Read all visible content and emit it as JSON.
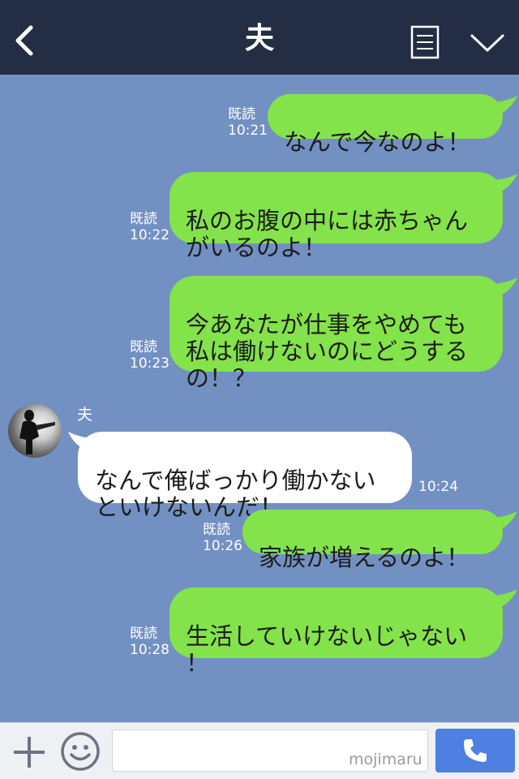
{
  "header": {
    "title": "夫",
    "back_icon": "chevron-left-icon",
    "menu_icon": "notes-icon",
    "dropdown_icon": "chevron-down-icon"
  },
  "colors": {
    "header_bg": "#232d44",
    "chat_bg": "#7390c2",
    "outgoing_bubble": "#84e24a",
    "incoming_bubble": "#ffffff",
    "call_button": "#4f7fe0"
  },
  "messages": [
    {
      "direction": "outgoing",
      "text": "なんで今なのよ！",
      "read": "既読",
      "time": "10:21"
    },
    {
      "direction": "outgoing",
      "text": "私のお腹の中には赤ちゃん\nがいるのよ！",
      "read": "既読",
      "time": "10:22"
    },
    {
      "direction": "outgoing",
      "text": "今あなたが仕事をやめても\n私は働けないのにどうする\nの！？",
      "read": "既読",
      "time": "10:23"
    },
    {
      "direction": "incoming",
      "sender": "夫",
      "text": "なんで俺ばっかり働かない\nといけないんだ！",
      "time": "10:24"
    },
    {
      "direction": "outgoing",
      "text": "家族が増えるのよ！",
      "read": "既読",
      "time": "10:26"
    },
    {
      "direction": "outgoing",
      "text": "生活していけないじゃない\n！",
      "read": "既読",
      "time": "10:28"
    }
  ],
  "input": {
    "value": "",
    "placeholder": "",
    "watermark": "mojimaru"
  },
  "bottom_icons": {
    "plus": "plus-icon",
    "emoji": "smiley-icon",
    "call": "phone-icon"
  }
}
